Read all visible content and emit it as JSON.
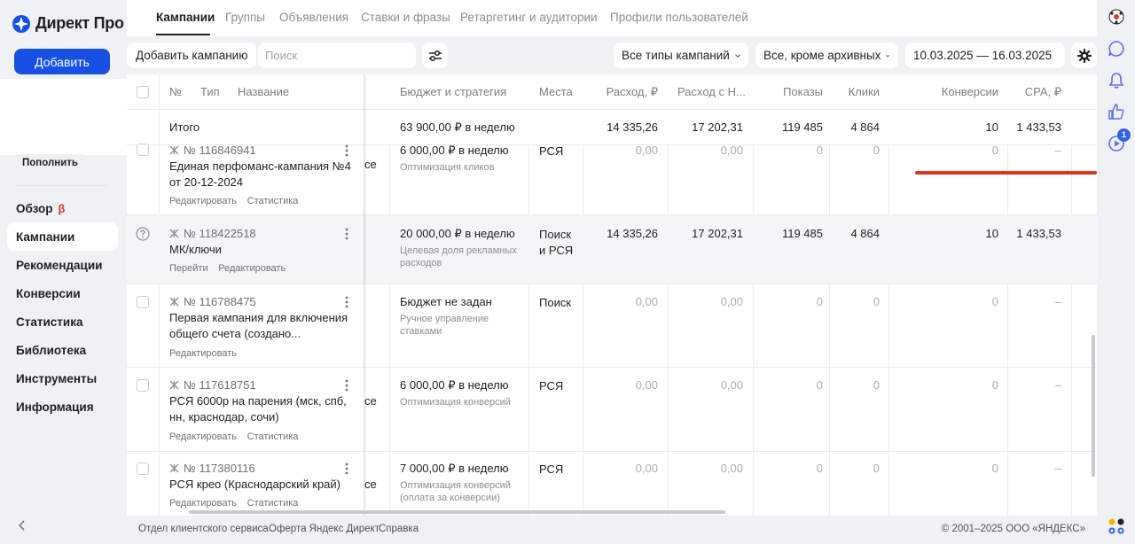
{
  "logo": {
    "text": "Директ Про"
  },
  "sidebar": {
    "add_label": "Добавить",
    "topup_label": "Пополнить",
    "nav": [
      {
        "label": "Обзор",
        "beta": "β"
      },
      {
        "label": "Кампании",
        "active": true
      },
      {
        "label": "Рекомендации"
      },
      {
        "label": "Конверсии"
      },
      {
        "label": "Статистика"
      },
      {
        "label": "Библиотека"
      },
      {
        "label": "Инструменты"
      },
      {
        "label": "Информация"
      }
    ]
  },
  "tabs": [
    {
      "label": "Кампании",
      "active": true
    },
    {
      "label": "Группы"
    },
    {
      "label": "Объявления"
    },
    {
      "label": "Ставки и фразы"
    },
    {
      "label": "Ретаргетинг и аудитории"
    },
    {
      "label": "Профили пользователей"
    }
  ],
  "toolbar": {
    "add_campaign": "Добавить кампанию",
    "search_placeholder": "Поиск",
    "campaign_types": "Все типы кампаний",
    "archive_filter": "Все, кроме архивных",
    "date_range": "10.03.2025 — 16.03.2025"
  },
  "table": {
    "headers": {
      "num": "№",
      "type": "Тип",
      "name": "Название",
      "budget": "Бюджет и стратегия",
      "places": "Места",
      "spend": "Расход, ₽",
      "spend_vat": "Расход с Н...",
      "impressions": "Показы",
      "clicks": "Клики",
      "conversions": "Конверсии",
      "cpa": "CPA, ₽"
    },
    "total": {
      "label": "Итого",
      "budget": "63 900,00 ₽ в неделю",
      "spend": "14 335,26",
      "spend_vat": "17 202,31",
      "impressions": "119 485",
      "clicks": "4 864",
      "conversions": "10",
      "cpa": "1 433,53"
    },
    "rows": [
      {
        "number": "№ 116846941",
        "name": "Единая перфоманс-кампания №4 от 20-12-2024",
        "links": [
          "Редактировать",
          "Статистика"
        ],
        "peek": "се",
        "budget": "6 000,00 ₽ в неделю",
        "strategy": "Оптимизация кликов",
        "places": "РСЯ",
        "spend": "0,00",
        "spend_vat": "0,00",
        "impressions": "0",
        "clicks": "0",
        "conversions": "0",
        "cpa": "–"
      },
      {
        "number": "№ 118422518",
        "name": "МК/ключи",
        "links": [
          "Перейти",
          "Редактировать"
        ],
        "peek": "",
        "budget": "20 000,00 ₽ в неделю",
        "strategy": "Целевая доля рекламных расходов",
        "places": "Поиск и РСЯ",
        "spend": "14 335,26",
        "spend_vat": "17 202,31",
        "impressions": "119 485",
        "clicks": "4 864",
        "conversions": "10",
        "cpa": "1 433,53"
      },
      {
        "number": "№ 116788475",
        "name": "Первая кампания для включения общего счета (создано...",
        "links": [
          "Редактировать"
        ],
        "peek": "",
        "budget": "Бюджет не задан",
        "strategy": "Ручное управление ставками",
        "places": "Поиск",
        "spend": "0,00",
        "spend_vat": "0,00",
        "impressions": "0",
        "clicks": "0",
        "conversions": "0",
        "cpa": "–"
      },
      {
        "number": "№ 117618751",
        "name": "РСЯ 6000р на парения (мск, спб, нн, краснодар, сочи)",
        "links": [
          "Редактировать",
          "Статистика"
        ],
        "peek": "се",
        "budget": "6 000,00 ₽ в неделю",
        "strategy": "Оптимизация конверсий",
        "places": "РСЯ",
        "spend": "0,00",
        "spend_vat": "0,00",
        "impressions": "0",
        "clicks": "0",
        "conversions": "0",
        "cpa": "–"
      },
      {
        "number": "№ 117380116",
        "name": "РСЯ крео (Краснодарский край)",
        "links": [
          "Редактировать",
          "Статистика"
        ],
        "peek": "се",
        "budget": "7 000,00 ₽ в неделю",
        "strategy": "Оптимизация конверсий (оплата за конверсии)",
        "places": "РСЯ",
        "spend": "0,00",
        "spend_vat": "0,00",
        "impressions": "0",
        "clicks": "0",
        "conversions": "0",
        "cpa": "–"
      }
    ]
  },
  "rail": {
    "badge": "1"
  },
  "footer": {
    "links": [
      "Отдел клиентского сервиса",
      "Оферта Яндекс Директ",
      "Справка"
    ],
    "copyright": "© 2001–2025 ООО «ЯНДЕКС»"
  }
}
